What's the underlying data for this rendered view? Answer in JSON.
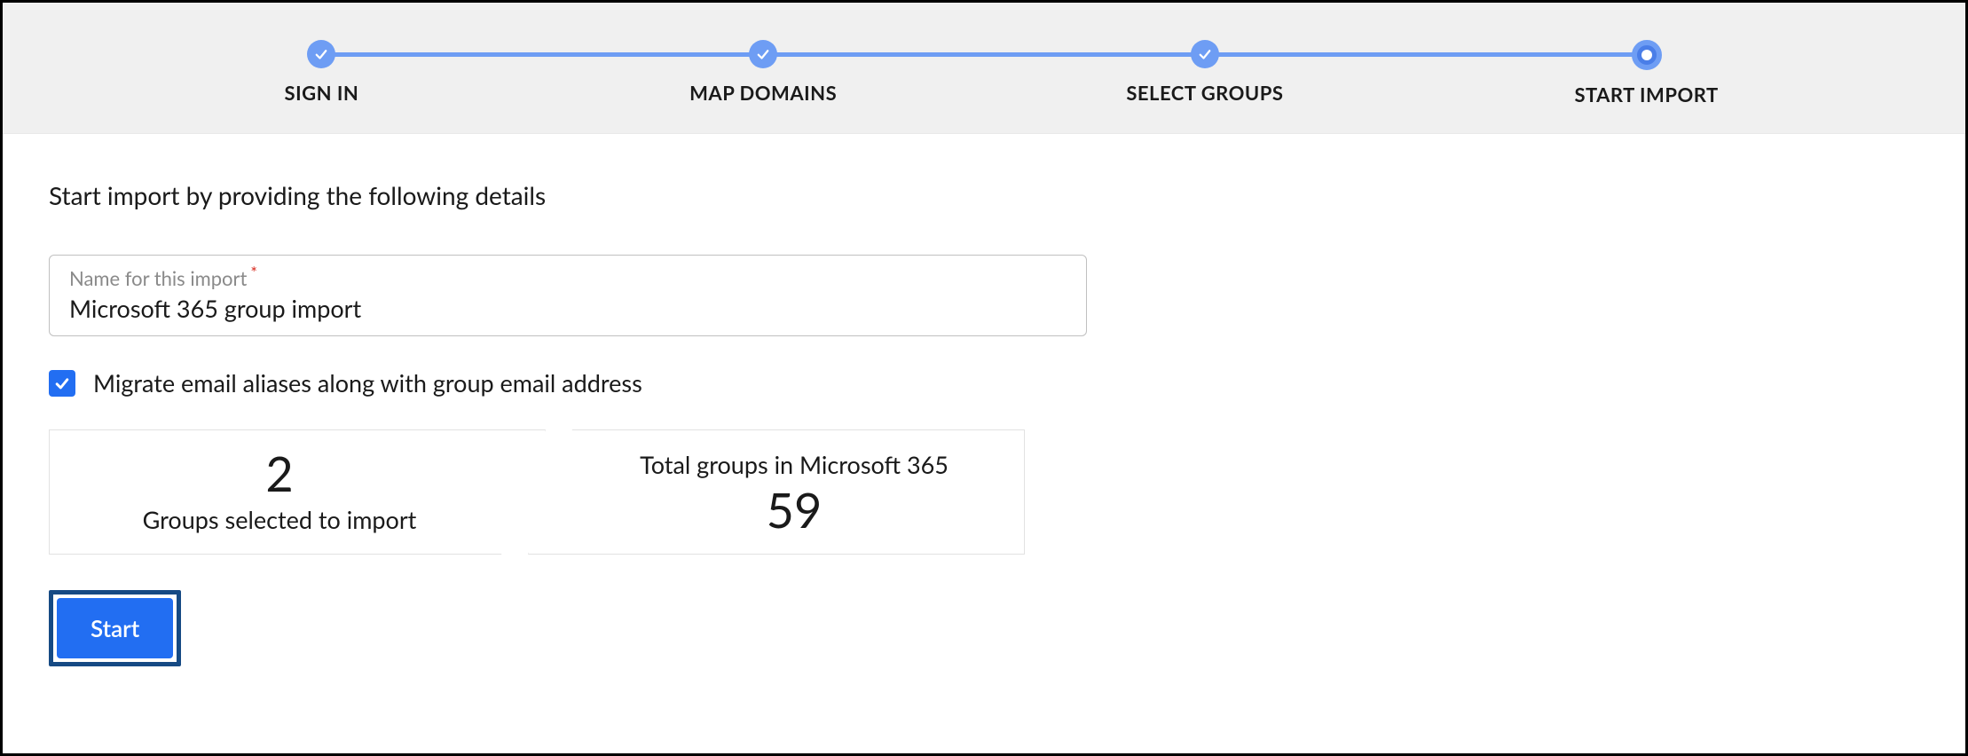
{
  "stepper": {
    "steps": [
      {
        "label": "SIGN IN",
        "state": "done"
      },
      {
        "label": "MAP DOMAINS",
        "state": "done"
      },
      {
        "label": "SELECT GROUPS",
        "state": "done"
      },
      {
        "label": "START IMPORT",
        "state": "current"
      }
    ]
  },
  "content": {
    "instruction": "Start import by providing the following details",
    "import_name_label": "Name for this import",
    "import_name_required": "*",
    "import_name_value": "Microsoft 365 group import",
    "migrate_aliases_checked": true,
    "migrate_aliases_label": "Migrate email aliases along with group email address",
    "selected_count": "2",
    "selected_label": "Groups selected to import",
    "total_label": "Total groups in Microsoft 365",
    "total_count": "59",
    "start_button": "Start"
  }
}
